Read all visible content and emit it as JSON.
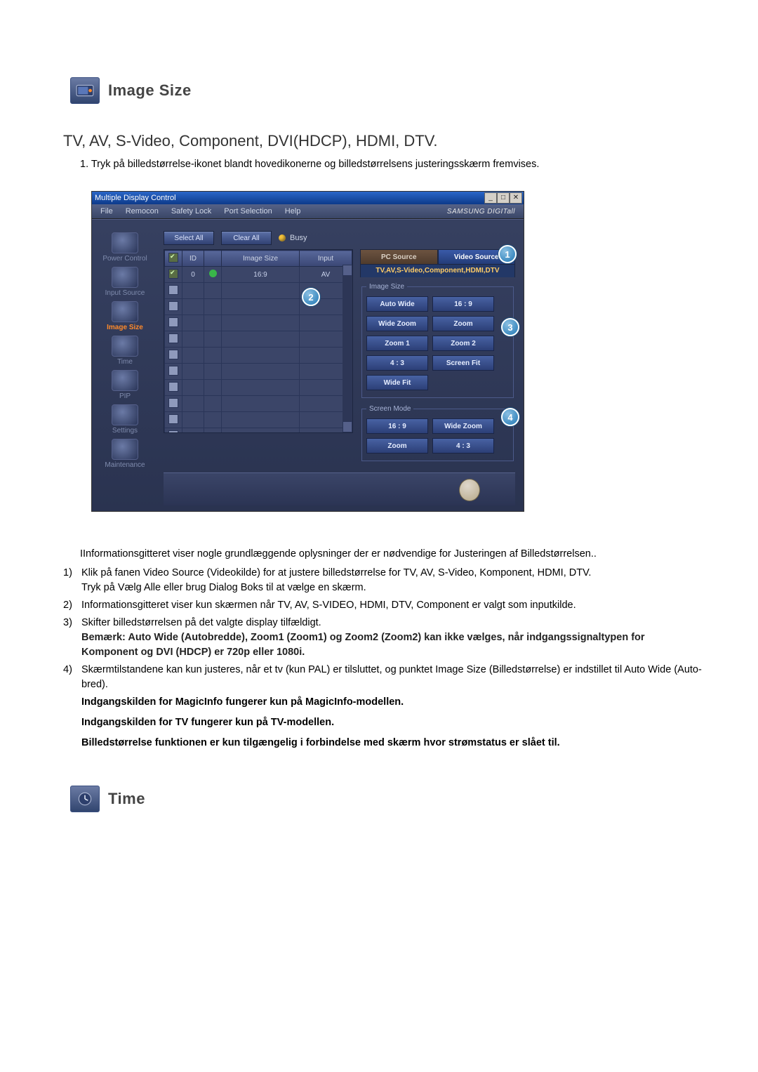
{
  "section1": {
    "title": "Image Size",
    "subtitle": "TV, AV, S-Video, Component, DVI(HDCP), HDMI, DTV.",
    "instruction": "1.  Tryk på billedstørrelse-ikonet blandt hovedikonerne og billedstørrelsens justeringsskærm fremvises."
  },
  "screenshot": {
    "window_title": "Multiple Display Control",
    "menus": [
      "File",
      "Remocon",
      "Safety Lock",
      "Port Selection",
      "Help"
    ],
    "brand": "SAMSUNG DIGITall",
    "sidebar": [
      {
        "label": "Power Control"
      },
      {
        "label": "Input Source"
      },
      {
        "label": "Image Size",
        "active": true
      },
      {
        "label": "Time"
      },
      {
        "label": "PIP"
      },
      {
        "label": "Settings"
      },
      {
        "label": "Maintenance"
      }
    ],
    "toolbar": {
      "select_all": "Select All",
      "clear_all": "Clear All",
      "busy": "Busy"
    },
    "grid": {
      "headers": [
        "",
        "ID",
        "",
        "Image Size",
        "Input"
      ],
      "row": {
        "id": "0",
        "image_size": "16:9",
        "input": "AV"
      }
    },
    "tabs": {
      "pc": "PC Source",
      "video": "Video Source",
      "sub": "TV,AV,S-Video,Component,HDMI,DTV"
    },
    "image_size_panel": {
      "legend": "Image Size",
      "buttons": [
        "Auto Wide",
        "16 : 9",
        "Wide Zoom",
        "Zoom",
        "Zoom 1",
        "Zoom 2",
        "4 : 3",
        "Screen Fit",
        "Wide Fit"
      ]
    },
    "screen_mode_panel": {
      "legend": "Screen Mode",
      "buttons": [
        "16 : 9",
        "Wide Zoom",
        "Zoom",
        "4 : 3"
      ]
    },
    "callouts": {
      "c1": "1",
      "c2": "2",
      "c3": "3",
      "c4": "4"
    }
  },
  "body": {
    "lead": "IInformationsgitteret viser nogle grundlæggende oplysninger der er nødvendige for Justeringen af Billedstørrelsen..",
    "items": [
      {
        "n": "1)",
        "t": "Klik på fanen Video Source (Videokilde) for at justere billedstørrelse for TV, AV, S-Video, Komponent, HDMI, DTV.",
        "sub": "Tryk på Vælg Alle eller brug Dialog Boks til at vælge en skærm."
      },
      {
        "n": "2)",
        "t": "Informationsgitteret viser kun skærmen når TV, AV, S-VIDEO, HDMI, DTV, Component er valgt som inputkilde."
      },
      {
        "n": "3)",
        "t": "Skifter billedstørrelsen på det valgte display tilfældigt.",
        "note_bold": "Bemærk: Auto Wide (Autobredde), Zoom1 (Zoom1) og Zoom2 (Zoom2) kan ikke vælges, når indgangssignaltypen for Komponent og DVI (HDCP) er 720p eller 1080i."
      },
      {
        "n": "4)",
        "t": "Skærmtilstandene kan kun justeres, når et tv (kun PAL) er tilsluttet, og punktet Image Size (Billedstørrelse) er indstillet til Auto Wide (Auto-bred)."
      }
    ],
    "tail_bold1": "Indgangskilden for MagicInfo fungerer kun på MagicInfo-modellen.",
    "tail_bold2": "Indgangskilden for TV fungerer kun på TV-modellen.",
    "tail_bold3": "Billedstørrelse funktionen er kun tilgængelig i forbindelse med skærm hvor strømstatus er slået til."
  },
  "section2": {
    "title": "Time"
  }
}
